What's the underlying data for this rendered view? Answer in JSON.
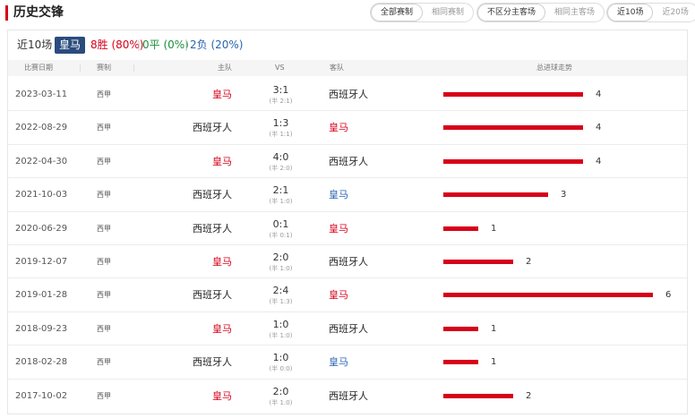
{
  "header": {
    "title": "历史交锋"
  },
  "filters": {
    "competition": [
      {
        "label": "全部赛制",
        "active": true
      },
      {
        "label": "相同赛制",
        "active": false
      }
    ],
    "venue": [
      {
        "label": "不区分主客场",
        "active": true
      },
      {
        "label": "相同主客场",
        "active": false
      }
    ],
    "count": [
      {
        "label": "近10场",
        "active": true
      },
      {
        "label": "近20场",
        "active": false
      }
    ]
  },
  "summary": {
    "label": "近10场",
    "team": "皇马",
    "wins": "8胜 (80%)",
    "draws": "0平 (0%)",
    "losses": "2负 (20%)",
    "separator": "|"
  },
  "table": {
    "columns": [
      "比赛日期",
      "赛制",
      "主队",
      "VS",
      "客队",
      "总进球走势"
    ],
    "max_goals": 6,
    "rows": [
      {
        "date": "2023-03-11",
        "comp": "西甲",
        "home": "皇马",
        "home_style": "red",
        "score": "3:1",
        "half": "(半 2:1)",
        "away": "西班牙人",
        "away_style": "dark",
        "goals": 4,
        "goals_label": "4"
      },
      {
        "date": "2022-08-29",
        "comp": "西甲",
        "home": "西班牙人",
        "home_style": "dark",
        "score": "1:3",
        "half": "(半 1:1)",
        "away": "皇马",
        "away_style": "red",
        "goals": 4,
        "goals_label": "4"
      },
      {
        "date": "2022-04-30",
        "comp": "西甲",
        "home": "皇马",
        "home_style": "red",
        "score": "4:0",
        "half": "(半 2:0)",
        "away": "西班牙人",
        "away_style": "dark",
        "goals": 4,
        "goals_label": "4"
      },
      {
        "date": "2021-10-03",
        "comp": "西甲",
        "home": "西班牙人",
        "home_style": "dark",
        "score": "2:1",
        "half": "(半 1:0)",
        "away": "皇马",
        "away_style": "blue",
        "goals": 3,
        "goals_label": "3"
      },
      {
        "date": "2020-06-29",
        "comp": "西甲",
        "home": "西班牙人",
        "home_style": "dark",
        "score": "0:1",
        "half": "(半 0:1)",
        "away": "皇马",
        "away_style": "red",
        "goals": 1,
        "goals_label": "1"
      },
      {
        "date": "2019-12-07",
        "comp": "西甲",
        "home": "皇马",
        "home_style": "red",
        "score": "2:0",
        "half": "(半 1:0)",
        "away": "西班牙人",
        "away_style": "dark",
        "goals": 2,
        "goals_label": "2"
      },
      {
        "date": "2019-01-28",
        "comp": "西甲",
        "home": "西班牙人",
        "home_style": "dark",
        "score": "2:4",
        "half": "(半 1:3)",
        "away": "皇马",
        "away_style": "red",
        "goals": 6,
        "goals_label": "6"
      },
      {
        "date": "2018-09-23",
        "comp": "西甲",
        "home": "皇马",
        "home_style": "red",
        "score": "1:0",
        "half": "(半 1:0)",
        "away": "西班牙人",
        "away_style": "dark",
        "goals": 1,
        "goals_label": "1"
      },
      {
        "date": "2018-02-28",
        "comp": "西甲",
        "home": "西班牙人",
        "home_style": "dark",
        "score": "1:0",
        "half": "(半 0:0)",
        "away": "皇马",
        "away_style": "blue",
        "goals": 1,
        "goals_label": "1"
      },
      {
        "date": "2017-10-02",
        "comp": "西甲",
        "home": "皇马",
        "home_style": "red",
        "score": "2:0",
        "half": "(半 1:0)",
        "away": "西班牙人",
        "away_style": "dark",
        "goals": 2,
        "goals_label": "2"
      }
    ]
  },
  "colors": {
    "accent": "#d7001a",
    "win": "#d7001a",
    "draw": "#1a8f3a",
    "loss": "#2a64b0",
    "badge": "#2a4c7d"
  }
}
